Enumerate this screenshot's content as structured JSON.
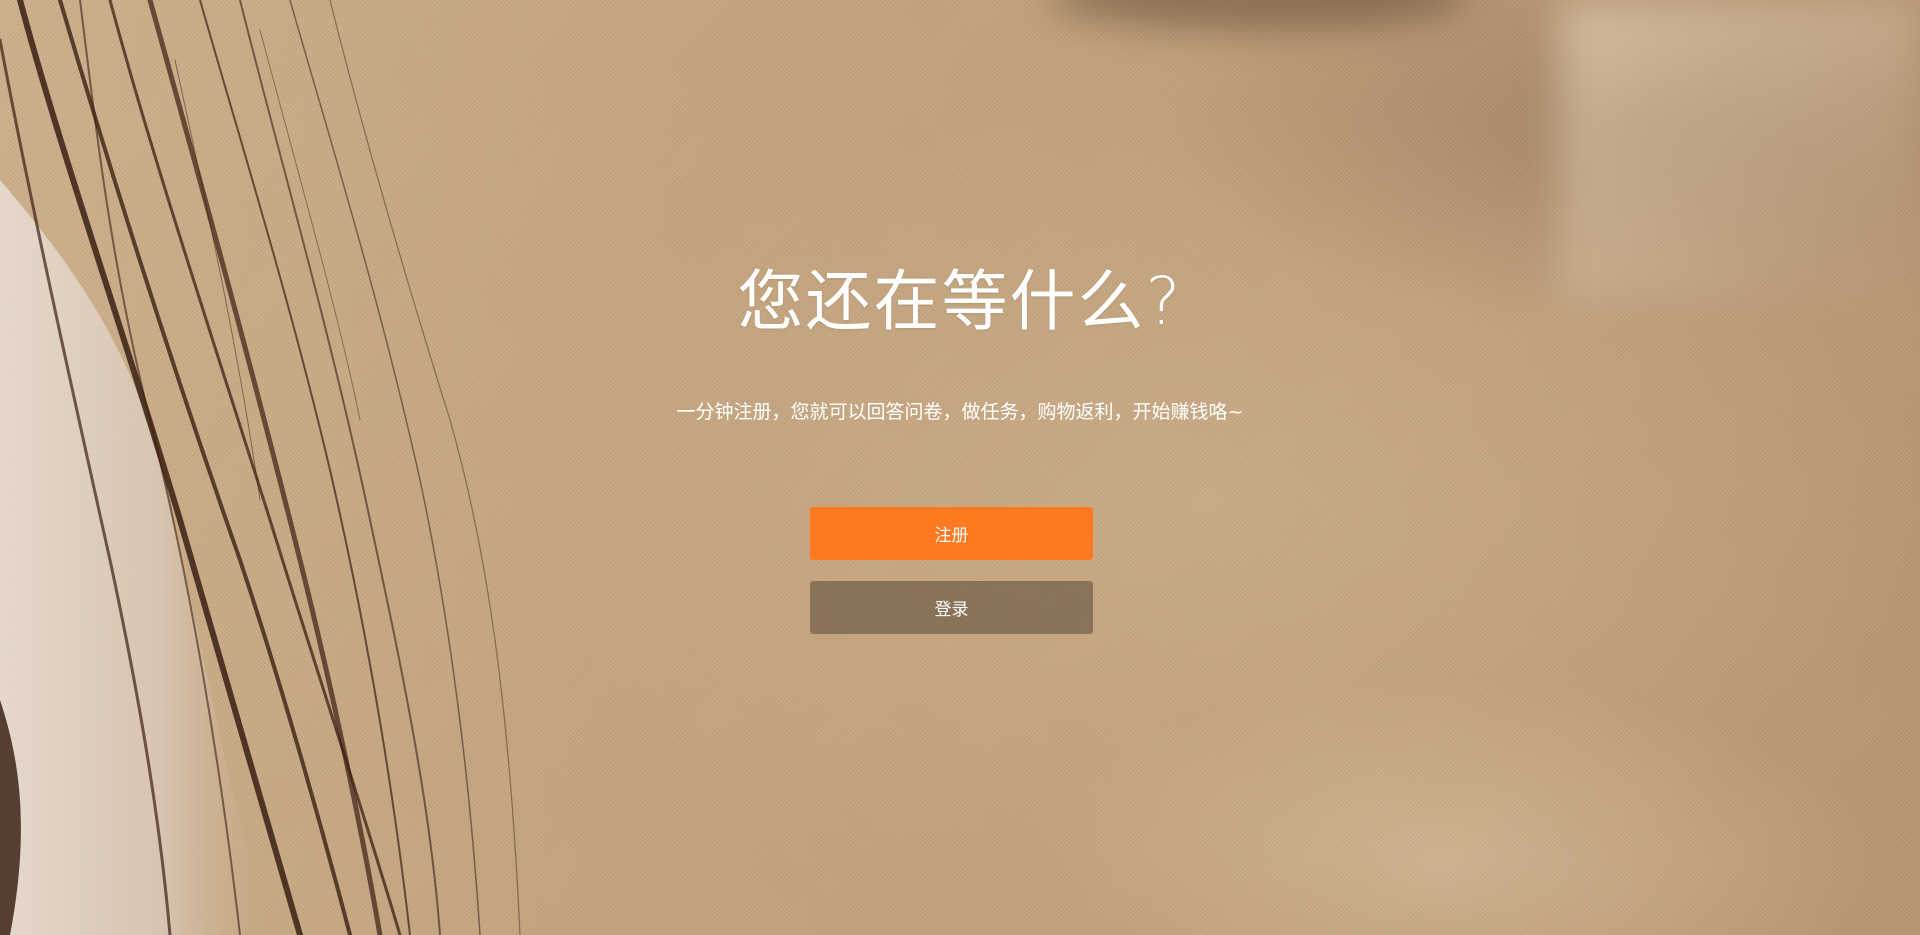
{
  "hero": {
    "title": "您还在等什么?",
    "subtitle": "一分钟注册，您就可以回答问卷，做任务，购物返利，开始赚钱咯~"
  },
  "actions": {
    "register_label": "注册",
    "login_label": "登录"
  },
  "colors": {
    "register_button": "#ff7921",
    "login_button": "#5a4837",
    "background": "#c4a47e",
    "text": "#ffffff"
  }
}
